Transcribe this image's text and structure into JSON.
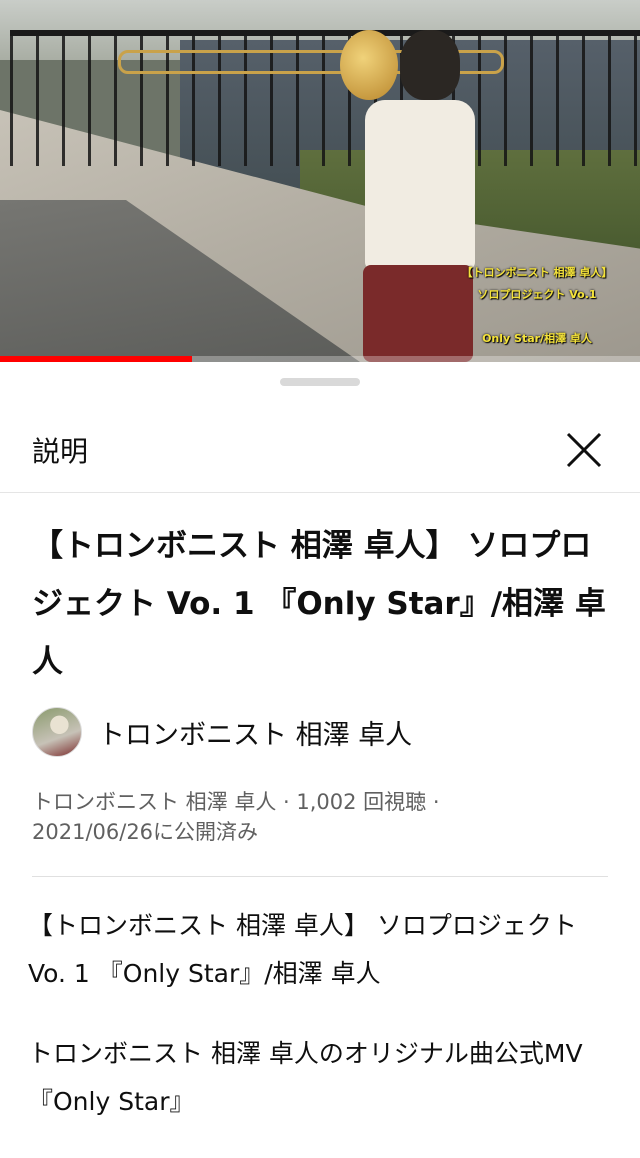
{
  "video": {
    "overlay_lines": [
      "【トロンボニスト 相澤 卓人】",
      "ソロプロジェクト Vo.1",
      "",
      "Only Star/相澤 卓人"
    ],
    "progress": 0.3,
    "accent_color": "#ff0000"
  },
  "sheet": {
    "title": "説明",
    "close_icon": "close-icon"
  },
  "description": {
    "video_title": "【トロンボニスト 相澤 卓人】 ソロプロジェクト Vo. 1 『Only Star』/相澤 卓人",
    "channel_name": "トロンボニスト 相澤 卓人",
    "meta_line1": "トロンボニスト 相澤 卓人 · 1,002 回視聴 ·",
    "meta_line2": "2021/06/26に公開済み",
    "body": [
      "【トロンボニスト 相澤 卓人】 ソロプロジェクト Vo. 1 『Only Star』/相澤 卓人",
      "トロンボニスト 相澤 卓人のオリジナル曲公式MV『Only Star』"
    ]
  }
}
